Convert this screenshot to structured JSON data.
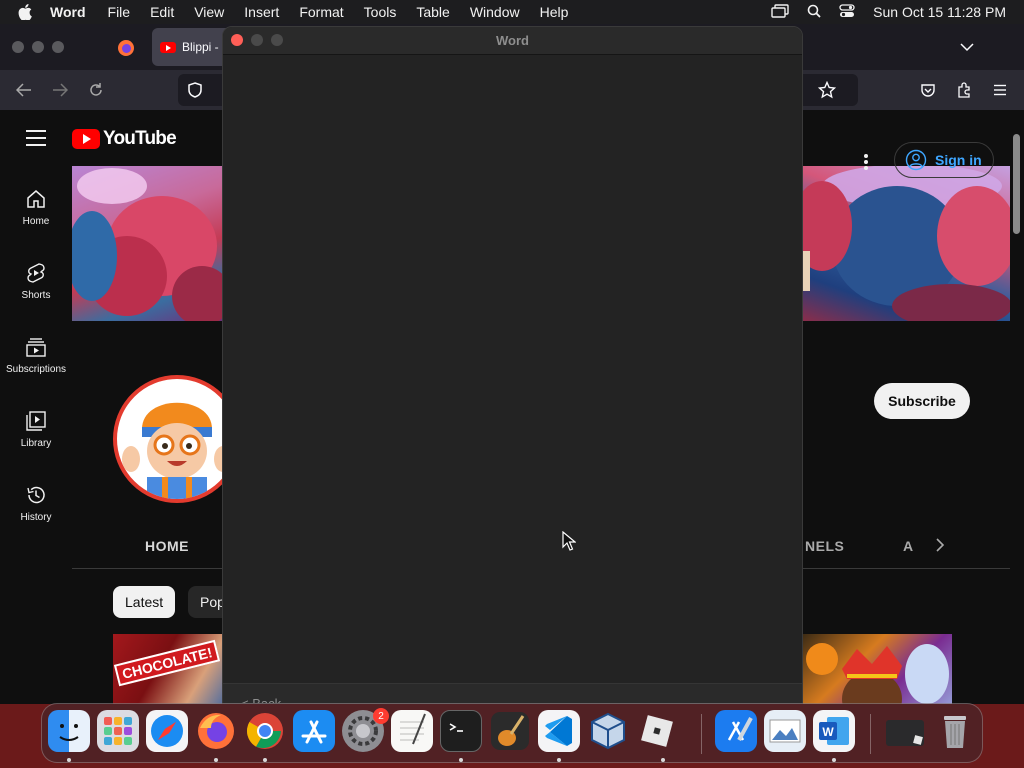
{
  "menubar": {
    "app_name": "Word",
    "items": [
      "File",
      "Edit",
      "View",
      "Insert",
      "Format",
      "Tools",
      "Table",
      "Window",
      "Help"
    ],
    "clock": "Sun Oct 15  11:28 PM"
  },
  "browser": {
    "active_tab_title": "Blippi -"
  },
  "youtube": {
    "logo_text": "YouTube",
    "sidebar": [
      {
        "label": "Home",
        "icon": "home-icon"
      },
      {
        "label": "Shorts",
        "icon": "shorts-icon"
      },
      {
        "label": "Subscriptions",
        "icon": "subscriptions-icon"
      },
      {
        "label": "Library",
        "icon": "library-icon"
      },
      {
        "label": "History",
        "icon": "history-icon"
      }
    ],
    "sign_in_label": "Sign in",
    "subscribe_label": "Subscribe",
    "tabs": {
      "home": "HOME",
      "channels_partial": "NELS",
      "about_partial": "A"
    },
    "chips": {
      "latest": "Latest",
      "popular_partial": "Pop"
    },
    "thumbnail_text": "CHOCOLATE!"
  },
  "word": {
    "window_title": "Word",
    "footer_back_partial": "< Back"
  },
  "dock": {
    "items": [
      "finder",
      "launchpad",
      "safari",
      "firefox",
      "chrome",
      "app-store",
      "system-settings",
      "textedit",
      "terminal",
      "garageband",
      "vscode",
      "virtualbox",
      "roblox",
      "xcode",
      "preview",
      "word",
      "downloads",
      "trash"
    ],
    "settings_badge": "2"
  },
  "colors": {
    "youtube_red": "#ff0000",
    "link_blue": "#3ea6ff",
    "desktop": "#6b1a1a"
  }
}
